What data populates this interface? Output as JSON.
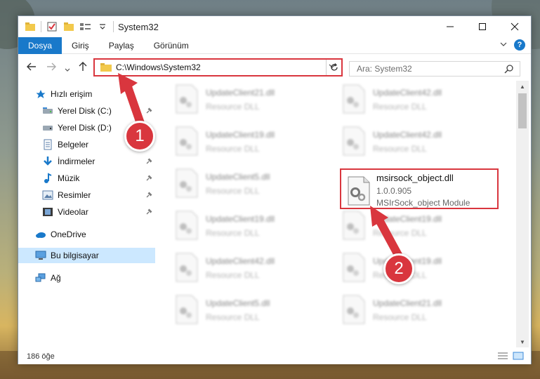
{
  "window": {
    "title": "System32"
  },
  "ribbon": {
    "tabs": [
      "Dosya",
      "Giriş",
      "Paylaş",
      "Görünüm"
    ]
  },
  "address": {
    "path": "C:\\Windows\\System32"
  },
  "search": {
    "placeholder": "Ara: System32"
  },
  "nav": {
    "quick_access": "Hızlı erişim",
    "items": [
      {
        "label": "Yerel Disk (C:)",
        "icon": "drive-icon"
      },
      {
        "label": "Yerel Disk (D:)",
        "icon": "drive-icon"
      },
      {
        "label": "Belgeler",
        "icon": "documents-icon"
      },
      {
        "label": "İndirmeler",
        "icon": "download-icon"
      },
      {
        "label": "Müzik",
        "icon": "music-icon"
      },
      {
        "label": "Resimler",
        "icon": "pictures-icon"
      },
      {
        "label": "Videolar",
        "icon": "videos-icon"
      }
    ],
    "onedrive": "OneDrive",
    "this_pc": "Bu bilgisayar",
    "network": "Ağ"
  },
  "files": [
    {
      "name": "UpdateClient21.dll",
      "desc": "Resource DLL"
    },
    {
      "name": "UpdateClient42.dll",
      "desc": "Resource DLL"
    },
    {
      "name": "UpdateClient19.dll",
      "desc": "Resource DLL"
    },
    {
      "name": "UpdateClient42.dll",
      "desc": "Resource DLL"
    },
    {
      "name": "UpdateClient5.dll",
      "desc": "Resource DLL"
    },
    {
      "name": "UpdateClient19.dll",
      "desc": "Resource DLL"
    },
    {
      "name": "UpdateClient19.dll",
      "desc": "Resource DLL"
    },
    {
      "name": "UpdateClient42.dll",
      "desc": "Resource DLL"
    },
    {
      "name": "UpdateClient19.dll",
      "desc": "Resource DLL"
    },
    {
      "name": "UpdateClient5.dll",
      "desc": "Resource DLL"
    },
    {
      "name": "UpdateClient21.dll",
      "desc": "Resource DLL"
    }
  ],
  "highlight": {
    "name": "msirsock_object.dll",
    "version": "1.0.0.905",
    "desc": "MSIrSock_object Module"
  },
  "status": {
    "count": "186 öğe"
  },
  "annotations": [
    "1",
    "2"
  ],
  "colors": {
    "accent": "#1979ca",
    "annotation": "#d9363e"
  }
}
